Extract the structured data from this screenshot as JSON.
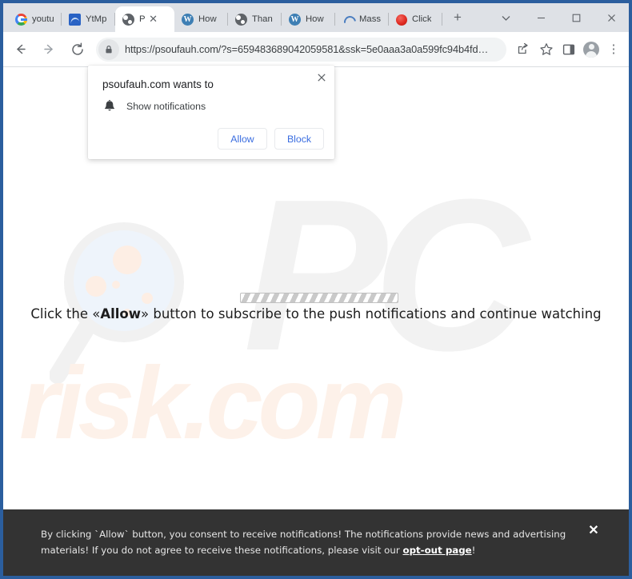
{
  "browser": {
    "tabs": [
      {
        "label": "youtu",
        "favicon": "google-g-icon",
        "active": false
      },
      {
        "label": "YtMp",
        "favicon": "ytmp-wave-icon",
        "active": false
      },
      {
        "label": "P",
        "favicon": "globe-icon",
        "active": true
      },
      {
        "label": "How",
        "favicon": "wordpress-icon",
        "active": false
      },
      {
        "label": "Than",
        "favicon": "globe-icon",
        "active": false
      },
      {
        "label": "How",
        "favicon": "wordpress-icon",
        "active": false
      },
      {
        "label": "Mass",
        "favicon": "arc-spinner-icon",
        "active": false
      },
      {
        "label": "Click",
        "favicon": "red-dot-icon",
        "active": false
      }
    ],
    "new_tab_label": "+",
    "active_tab_close_label": "✕",
    "window_controls": {
      "tab_search_label": "⌄",
      "minimize_label": "─",
      "maximize_label": "□",
      "close_label": "✕"
    },
    "toolbar": {
      "back_label": "←",
      "forward_label": "→",
      "reload_label": "↻",
      "url": "https://psoufauh.com/?s=659483689042059581&ssk=5e0aaa3a0a599fc94b4fd…",
      "menu_label": "⋮"
    }
  },
  "permission_bubble": {
    "title": "psoufauh.com wants to",
    "permission": "Show notifications",
    "allow_label": "Allow",
    "block_label": "Block",
    "close_label": "✕"
  },
  "page": {
    "cta_prefix": "Click the «",
    "cta_bold": "Allow",
    "cta_suffix": "» button to subscribe to the push notifications and continue watching",
    "watermark_pc": "PC",
    "watermark_risk": "risk.com"
  },
  "consent_banner": {
    "text_part1": "By clicking `Allow` button, you consent to receive notifications! The notifications provide news and advertising materials! If you do not agree to receive these notifications, please visit our ",
    "link_text": "opt-out page",
    "text_part2": "!",
    "close_label": "✕"
  },
  "colors": {
    "frame": "#2b5e9e",
    "tab_strip": "#dee1e6",
    "omnibox": "#f1f3f4",
    "bubble_action": "#3b6ee0",
    "banner": "#333333",
    "watermark_pc": "#f2f2f2",
    "watermark_risk": "#fdf1e9"
  }
}
